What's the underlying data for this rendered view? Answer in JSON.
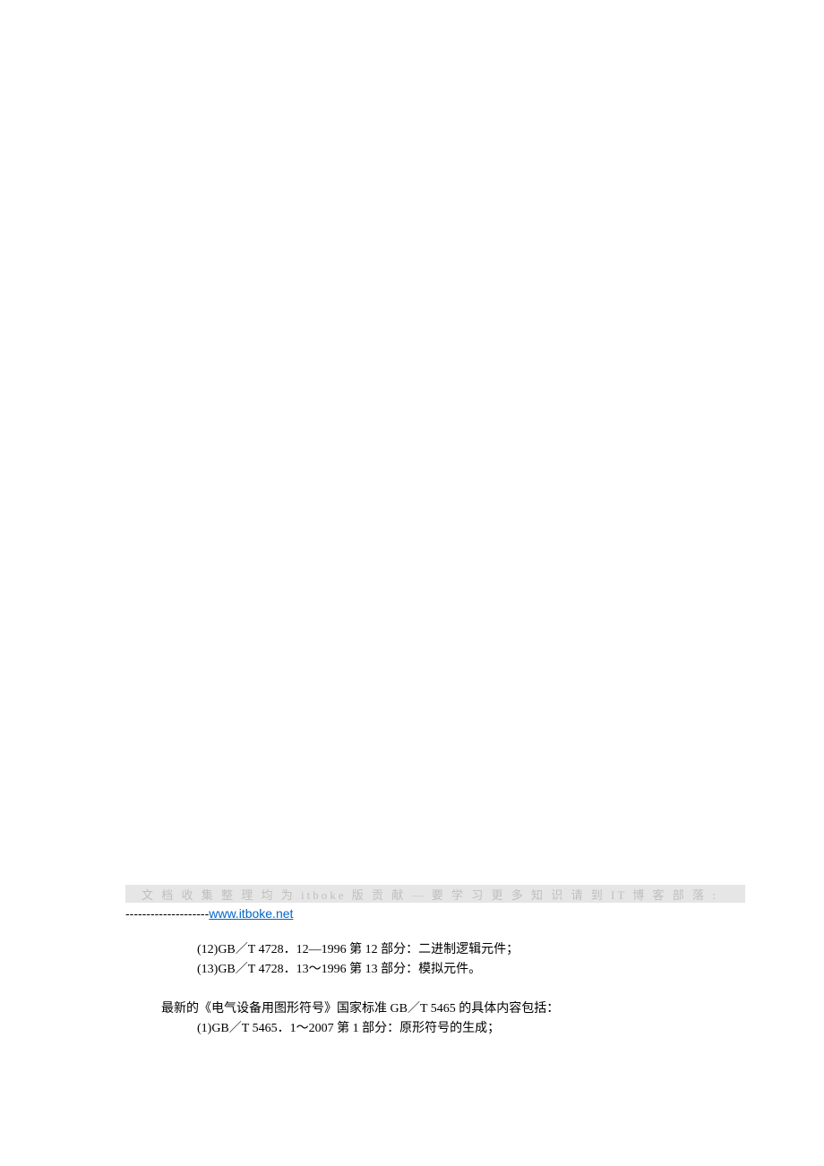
{
  "watermark": {
    "text": "文 档 收 集 整 理 均 为 itboke 版 贡 献 — 要 学 习 更 多 知 识 请 到 IT 博 客 部 落 :"
  },
  "link": {
    "dashes": "--------------------",
    "url_text": "www.itboke.net"
  },
  "content": {
    "item12": "(12)GB／T 4728．12—1996 第 12 部分：二进制逻辑元件；",
    "item13": "(13)GB／T 4728．13～1996 第 13 部分：模拟元件。",
    "section_intro": "最新的《电气设备用图形符号》国家标准 GB／T 5465 的具体内容包括：",
    "item1": "(1)GB／T 5465．1～2007 第 1 部分：原形符号的生成；"
  }
}
